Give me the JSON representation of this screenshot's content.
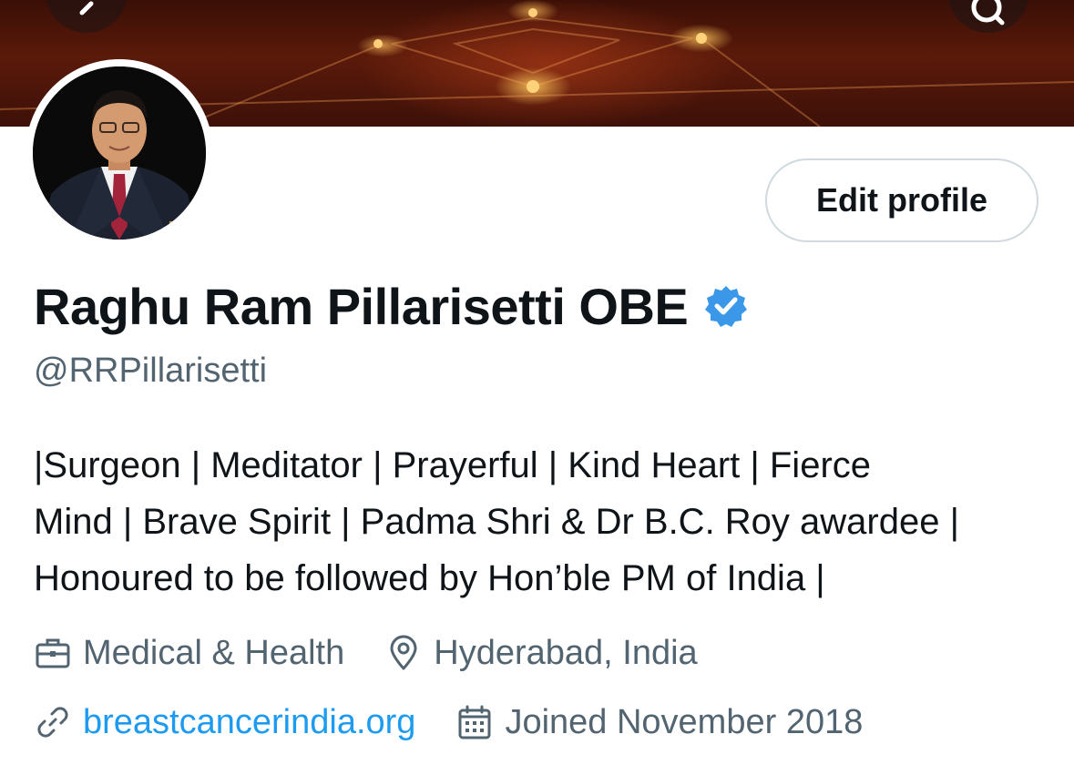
{
  "header": {
    "back_icon": "arrow-left-icon",
    "search_icon": "search-icon"
  },
  "profile": {
    "display_name": "Raghu Ram Pillarisetti OBE",
    "verified_icon": "verified-badge-icon",
    "verified_color": "#3b98e8",
    "handle": "@RRPillarisetti",
    "edit_button_label": "Edit profile",
    "bio_lines": [
      "|Surgeon | Meditator | Prayerful | Kind Heart | Fierce",
      "Mind | Brave Spirit | Padma Shri & Dr B.C. Roy awardee |",
      "Honoured to be followed by Hon’ble PM of India |"
    ],
    "category": "Medical & Health",
    "category_icon": "briefcase-icon",
    "location": "Hyderabad, India",
    "location_icon": "location-pin-icon",
    "website": "breastcancerindia.org",
    "website_icon": "link-icon",
    "joined": "Joined November 2018",
    "joined_icon": "calendar-icon"
  },
  "colors": {
    "text_primary": "#0f1419",
    "text_secondary": "#536471",
    "link": "#1d9bf0",
    "button_border": "#cfd9de"
  }
}
